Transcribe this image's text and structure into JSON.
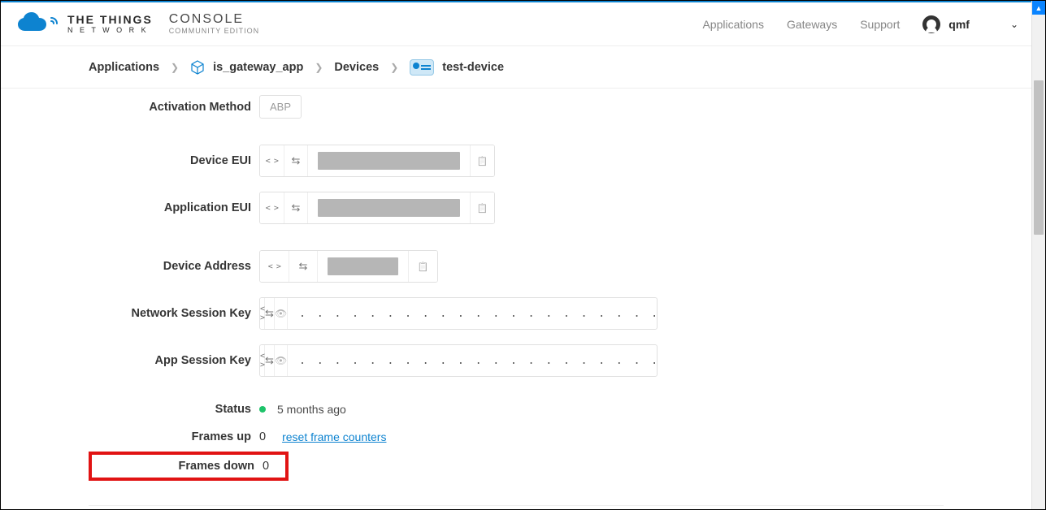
{
  "nav": {
    "brand1": "THE THINGS",
    "brand2": "N E T W O R K",
    "console1": "CONSOLE",
    "console2": "COMMUNITY EDITION",
    "links": {
      "applications": "Applications",
      "gateways": "Gateways",
      "support": "Support"
    },
    "username": "qmf"
  },
  "breadcrumb": {
    "applications": "Applications",
    "app_name": "is_gateway_app",
    "devices": "Devices",
    "device_name": "test-device"
  },
  "form": {
    "activation_method_label": "Activation Method",
    "activation_method_value": "ABP",
    "device_eui_label": "Device EUI",
    "application_eui_label": "Application EUI",
    "device_address_label": "Device Address",
    "nwk_session_key_label": "Network Session Key",
    "nwk_session_key_mask": ". .   . .   . .   . .   . .   . .   . .   . .   . .   . .   . .   . .   . .   . .   . .   . .",
    "app_session_key_label": "App Session Key",
    "app_session_key_mask": ". .   . .   . .   . .   . .   . .   . .   . .   . .   . .   . .   . .   . .   . .   . .   . .",
    "status_label": "Status",
    "status_value": "5 months ago",
    "frames_up_label": "Frames up",
    "frames_up_value": "0",
    "reset_link": "reset frame counters",
    "frames_down_label": "Frames down",
    "frames_down_value": "0"
  }
}
